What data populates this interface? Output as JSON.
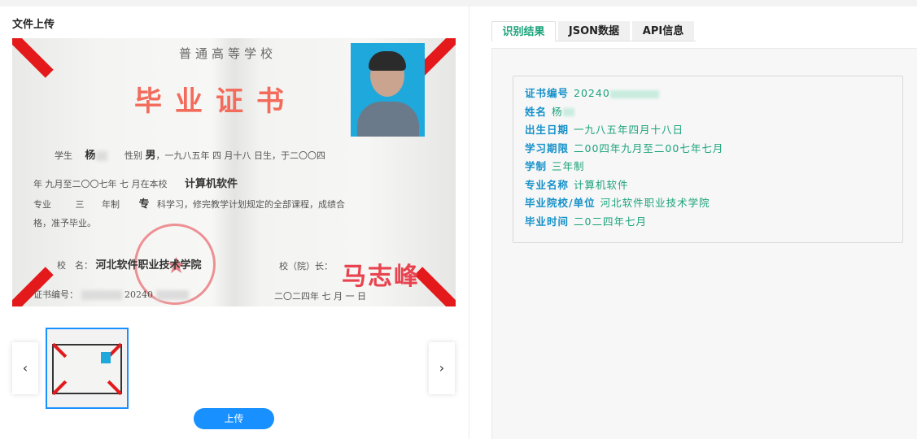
{
  "left": {
    "title": "文件上传",
    "upload_label": "上传",
    "prev_icon": "‹",
    "next_icon": "›"
  },
  "certificate": {
    "school_type": "普通高等学校",
    "title": "毕业证书",
    "line1_student": "学生",
    "line1_name": "杨",
    "line1_gender_label": "性别",
    "line1_gender": "男",
    "line1_rest": "，一九八五年 四 月十八 日生，于二〇〇四",
    "line2": "年 九月至二〇〇七年 七 月在本校",
    "line2_major": "计算机软件",
    "line3_a": "专业",
    "line3_b": "三",
    "line3_c": "年制",
    "line3_d": "专",
    "line3_e": "科学习，修完教学计划规定的全部课程，成绩合",
    "line4": "格，准予毕业。",
    "school_label": "校　名：",
    "school_name": "河北软件职业技术学院",
    "principal_label": "校（院）长：",
    "signature": "马志峰",
    "cert_no_label": "证书编号：",
    "cert_no_visible": "20240",
    "issue_date": "二〇二四年 七 月 一 日"
  },
  "tabs": {
    "result": "识别结果",
    "json": "JSON数据",
    "api": "API信息"
  },
  "result": {
    "rows": [
      {
        "key": "证书编号",
        "value": "20240"
      },
      {
        "key": "姓名",
        "value": "杨"
      },
      {
        "key": "出生日期",
        "value": "一九八五年四月十八日"
      },
      {
        "key": "学习期限",
        "value": "二00四年九月至二00七年七月"
      },
      {
        "key": "学制",
        "value": "三年制"
      },
      {
        "key": "专业名称",
        "value": "计算机软件"
      },
      {
        "key": "毕业院校/单位",
        "value": "河北软件职业技术学院"
      },
      {
        "key": "毕业时间",
        "value": "二0二四年七月"
      }
    ]
  },
  "colors": {
    "accent": "#1890ff",
    "key_blue": "#1591c9",
    "value_green": "#1aa37a"
  }
}
